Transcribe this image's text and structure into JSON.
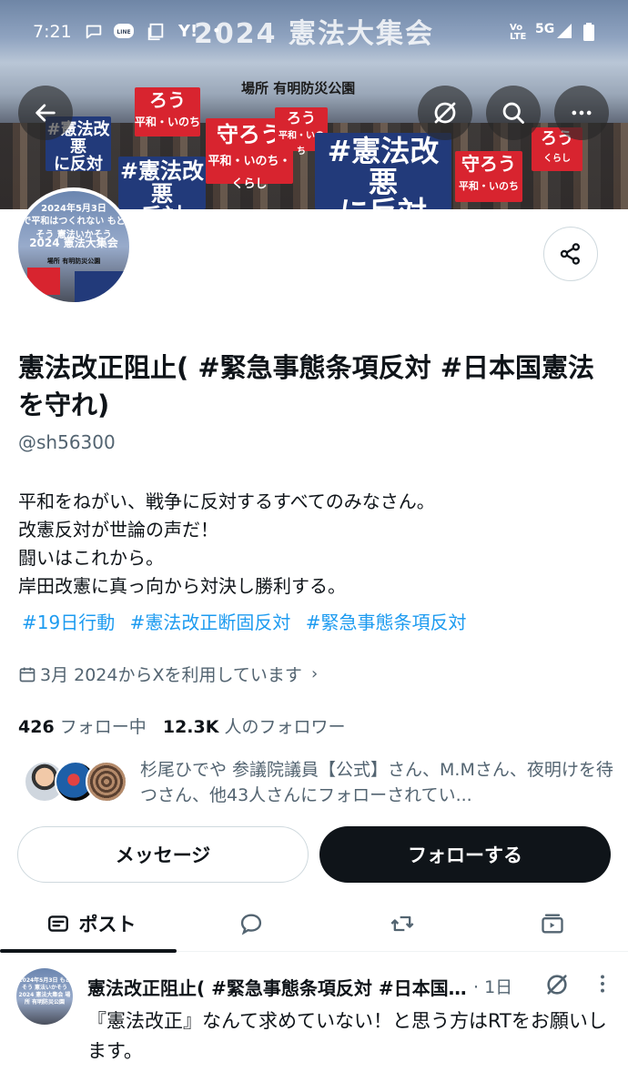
{
  "status_bar": {
    "time": "7:21",
    "network_label": "Vo LTE",
    "network_type": "5G",
    "icons": [
      "chat-bubble-icon",
      "line-app-icon",
      "copy-icon",
      "yahoo-icon",
      "dot-icon",
      "wifi-signal-icon",
      "signal-icon",
      "battery-icon"
    ]
  },
  "banner": {
    "title": "2024 憲法大集会",
    "place": "場所 有明防災公園",
    "signs": [
      "#憲法改悪 に反対",
      "守ろう 平和・いのち・くらし",
      "#憲法改悪 に反対",
      "守ろう",
      "#憲法改悪"
    ]
  },
  "avatar": {
    "line1": "2024年5月3日",
    "line2": "で平和はつくれない もどそう 憲法いかそう",
    "line3": "2024 憲法大集会",
    "line4": "場所 有明防災公園"
  },
  "profile": {
    "display_name": "憲法改正阻止( #緊急事態条項反対 #日本国憲法を守れ)",
    "handle": "@sh56300",
    "bio_lines": [
      "平和をねがい、戦争に反対するすべてのみなさん。",
      "改憲反対が世論の声だ！",
      "闘いはこれから。",
      "岸田改憲に真っ向から対決し勝利する。"
    ],
    "hashtags": [
      "#19日行動",
      "#憲法改正断固反対",
      "#緊急事態条項反対"
    ],
    "joined": "3月 2024からXを利用しています",
    "following_count": "426",
    "following_label": "フォロー中",
    "followers_count": "12.3K",
    "followers_label": "人のフォロワー",
    "followed_by_text": "杉尾ひでや 参議院議員【公式】さん、M.Mさん、夜明けを待つさん、他43人さんにフォローされてい..."
  },
  "buttons": {
    "message": "メッセージ",
    "follow": "フォローする"
  },
  "tabs": {
    "posts_label": "ポスト"
  },
  "post": {
    "author": "憲法改正阻止( #緊急事態条項反対 #日本国憲法を守れ)",
    "time": "· 1日",
    "text": "『憲法改正』なんて求めていない！と思う方はRTをお願いします。",
    "avatar_text": "2024年5月3日 もどそう 憲法いかそう 2024 憲法大集会 場所 有明防災公園"
  },
  "colors": {
    "accent": "#1d9bf0",
    "text_primary": "#0f1419",
    "text_secondary": "#536471",
    "border": "#cfd9de",
    "sign_red": "#d8242f",
    "sign_blue": "#223a7a"
  }
}
